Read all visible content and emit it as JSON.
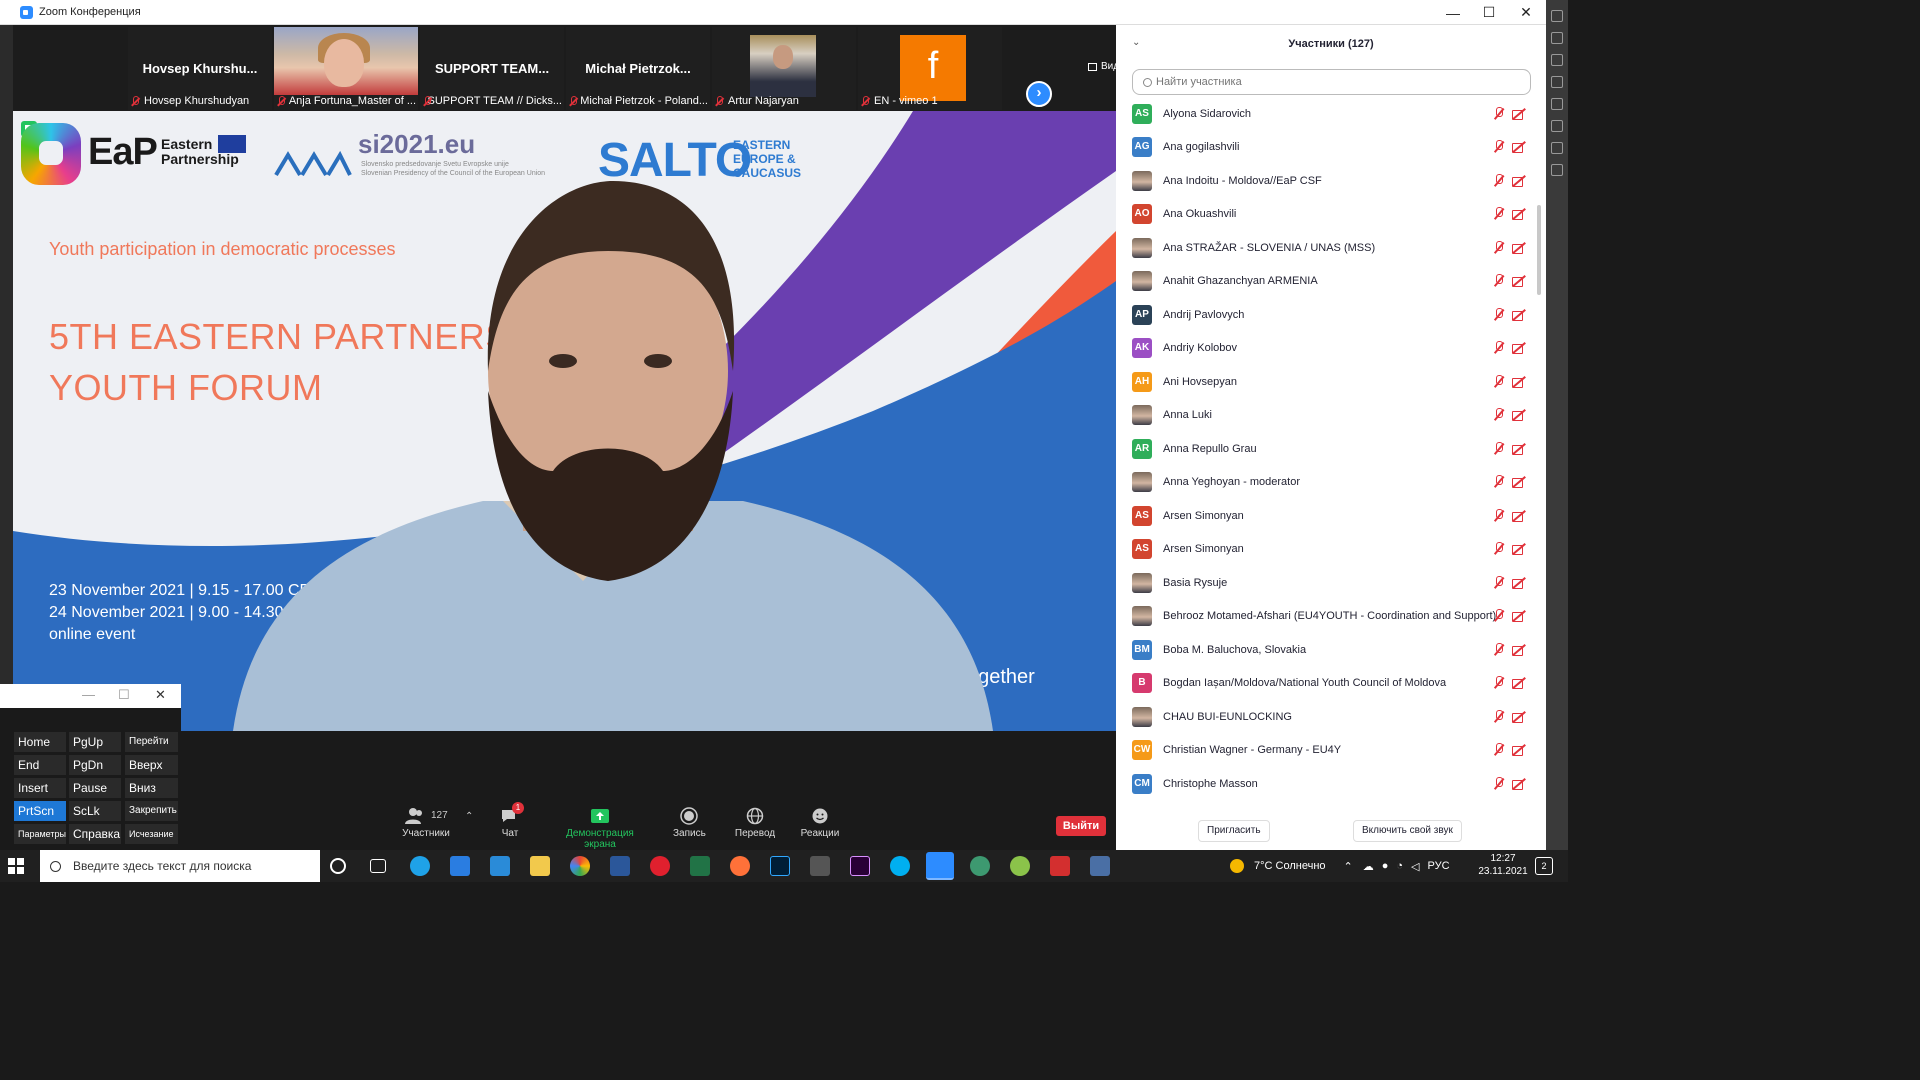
{
  "window": {
    "title": "Zoom Конференция",
    "controls": [
      "—",
      "☐",
      "✕"
    ]
  },
  "thumbnails": [
    {
      "display_name": "Hovsep  Khurshu...",
      "label": "Hovsep Khurshudyan",
      "kind": "name"
    },
    {
      "display_name": "",
      "label": "Anja Fortuna_Master of ...",
      "kind": "photo-woman"
    },
    {
      "display_name": "SUPPORT  TEAM...",
      "label": "SUPPORT TEAM // Dicks...",
      "kind": "name"
    },
    {
      "display_name": "Michał  Pietrzok...",
      "label": "Michał Pietrzok - Poland...",
      "kind": "name"
    },
    {
      "display_name": "",
      "label": "Artur Najaryan",
      "kind": "photo-man"
    },
    {
      "display_name": "f",
      "label": "EN - vimeo 1",
      "kind": "orange"
    }
  ],
  "view_button": {
    "label": "Вид"
  },
  "slide": {
    "eap_text": "EaP",
    "eap_sub_line1": "Eastern",
    "eap_sub_line2": "Partnership",
    "si_text": "si2021.eu",
    "si_sub_line1": "Slovensko predsedovanje Svetu Evropske unije",
    "si_sub_line2": "Slovenian Presidency of the Council of the European Union",
    "salto_text": "SALTO",
    "salto_sub_line1": "EASTERN",
    "salto_sub_line2": "EUROPE &",
    "salto_sub_line3": "CAUCASUS",
    "tagline": "Youth participation in democratic processes",
    "title_line1": "5TH EASTERN PARTNERSH",
    "title_line2": "YOUTH FORUM",
    "date_line1": "23 November 2021 | 9.15 - 17.00 CE",
    "date_line2": "24 November 2021 | 9.00 - 14.30",
    "date_line3": "online event",
    "together": "Together"
  },
  "ahk_keys": [
    {
      "label": "Home"
    },
    {
      "label": "PgUp"
    },
    {
      "label": "Перейти"
    },
    {
      "label": "End"
    },
    {
      "label": "PgDn"
    },
    {
      "label": "Вверх"
    },
    {
      "label": "Insert"
    },
    {
      "label": "Pause"
    },
    {
      "label": "Вниз"
    },
    {
      "label": "PrtScn"
    },
    {
      "label": "ScLk"
    },
    {
      "label": "Закрепить"
    },
    {
      "label": "Параметры"
    },
    {
      "label": "Справка"
    },
    {
      "label": "Исчезание"
    }
  ],
  "toolbar": {
    "participants_label": "Участники",
    "participants_count": "127",
    "chat_label": "Чат",
    "chat_badge": "1",
    "share_label": "Демонстрация экрана",
    "record_label": "Запись",
    "translate_label": "Перевод",
    "reactions_label": "Реакции",
    "leave_label": "Выйти",
    "share_color": "#23c45e"
  },
  "panel": {
    "title": "Участники (127)",
    "search_placeholder": "Найти участника",
    "invite_label": "Пригласить",
    "unmute_label": "Включить свой звук",
    "participants": [
      {
        "initials": "AS",
        "color": "#2fae5a",
        "name": "Alyona Sidarovich"
      },
      {
        "initials": "AG",
        "color": "#3a7ec7",
        "name": "Ana gogilashvili"
      },
      {
        "initials": "",
        "color": "photo",
        "name": "Ana Indoitu - Moldova//EaP CSF"
      },
      {
        "initials": "AO",
        "color": "#d2452f",
        "name": "Ana Okuashvili"
      },
      {
        "initials": "",
        "color": "photo",
        "name": "Ana STRAŽAR - SLOVENIA / UNAS (MSS)"
      },
      {
        "initials": "",
        "color": "photo",
        "name": "Anahit Ghazanchyan ARMENIA"
      },
      {
        "initials": "AP",
        "color": "#2b4257",
        "name": "Andrij Pavlovych"
      },
      {
        "initials": "AK",
        "color": "#9b4fc4",
        "name": "Andriy Kolobov"
      },
      {
        "initials": "AH",
        "color": "#f59a18",
        "name": "Ani Hovsepyan"
      },
      {
        "initials": "",
        "color": "photo",
        "name": "Anna Luki"
      },
      {
        "initials": "AR",
        "color": "#2fae5a",
        "name": "Anna Repullo Grau"
      },
      {
        "initials": "",
        "color": "photo",
        "name": "Anna Yeghoyan - moderator"
      },
      {
        "initials": "AS",
        "color": "#d2452f",
        "name": "Arsen Simonyan"
      },
      {
        "initials": "AS",
        "color": "#d2452f",
        "name": "Arsen Simonyan"
      },
      {
        "initials": "",
        "color": "photo",
        "name": "Basia Rysuje"
      },
      {
        "initials": "",
        "color": "photo",
        "name": "Behrooz Motamed-Afshari (EU4YOUTH - Coordination and Support)"
      },
      {
        "initials": "BM",
        "color": "#3a7ec7",
        "name": "Boba M. Baluchova, Slovakia"
      },
      {
        "initials": "B",
        "color": "#d63a6e",
        "name": "Bogdan Iașan/Moldova/National Youth Council of Moldova"
      },
      {
        "initials": "",
        "color": "photo",
        "name": "CHAU BUI-EUNLOCKING"
      },
      {
        "initials": "CW",
        "color": "#f59a18",
        "name": "Christian Wagner - Germany - EU4Y"
      },
      {
        "initials": "CM",
        "color": "#3a7ec7",
        "name": "Christophe Masson"
      }
    ]
  },
  "taskbar": {
    "search_placeholder": "Введите здесь текст для поиска",
    "weather": "7°C  Солнечно",
    "lang": "РУС",
    "time": "12:27",
    "date": "23.11.2021",
    "notifications": "2"
  }
}
